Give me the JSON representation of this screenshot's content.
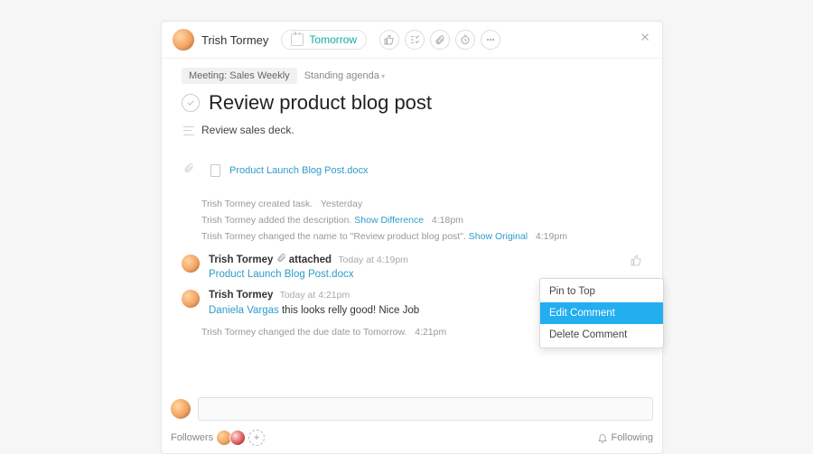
{
  "header": {
    "assignee": "Trish Tormey",
    "due_label": "Tomorrow"
  },
  "tags": {
    "project_chip": "Meeting: Sales Weekly",
    "section_dropdown": "Standing agenda"
  },
  "task": {
    "title": "Review product blog post",
    "description": "Review sales deck."
  },
  "attachment": {
    "filename": "Product Launch Blog Post.docx"
  },
  "log": [
    {
      "prefix": "Trish Tormey created task.",
      "ts": "Yesterday"
    },
    {
      "prefix": "Trish Tormey added the description.",
      "link": "Show Difference",
      "ts": "4:18pm"
    },
    {
      "prefix": "Trish Tormey changed the name to \"Review product blog post\".",
      "link": "Show Original",
      "ts": "4:19pm"
    }
  ],
  "comments": [
    {
      "author": "Trish Tormey",
      "verb": "attached",
      "ts": "Today at 4:19pm",
      "file": "Product Launch Blog Post.docx"
    },
    {
      "author": "Trish Tormey",
      "ts": "Today at 4:21pm",
      "mention": "Daniela Vargas",
      "text": "this looks relly good! Nice Job"
    }
  ],
  "log_tail": {
    "prefix": "Trish Tormey changed the due date to Tomorrow.",
    "ts": "4:21pm"
  },
  "menu": {
    "pin": "Pin to Top",
    "edit": "Edit Comment",
    "del": "Delete Comment"
  },
  "footer": {
    "followers_label": "Followers",
    "following_label": "Following"
  }
}
